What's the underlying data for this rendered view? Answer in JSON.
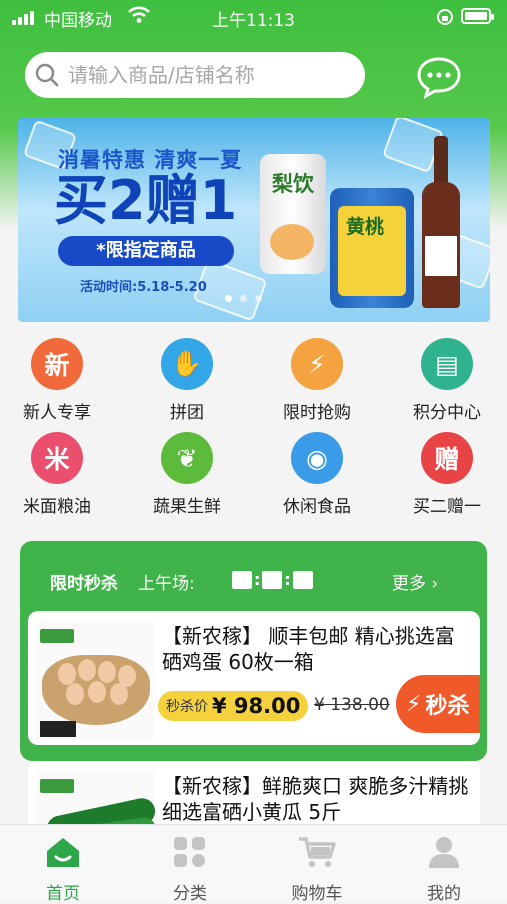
{
  "status": {
    "carrier": "中国移动",
    "time": "上午11:13"
  },
  "search": {
    "placeholder": "请输入商品/店铺名称"
  },
  "banner": {
    "headline": "消暑特惠 清爽一夏",
    "promo": "买2赠1",
    "tag": "*限指定商品",
    "dates": "活动时间:5.18-5.20",
    "product1": "梨饮",
    "product2": "黄桃"
  },
  "categories": [
    {
      "label": "新人专享",
      "glyph": "新",
      "color": "#f06a3b",
      "icon": "new-icon"
    },
    {
      "label": "拼团",
      "glyph": "✋",
      "color": "#33a6e8",
      "icon": "group-hands-icon"
    },
    {
      "label": "限时抢购",
      "glyph": "⚡",
      "color": "#f5a341",
      "icon": "flash-bolt-icon"
    },
    {
      "label": "积分中心",
      "glyph": "▤",
      "color": "#2fb38f",
      "icon": "points-icon"
    },
    {
      "label": "米面粮油",
      "glyph": "米",
      "color": "#ea4f6e",
      "icon": "rice-icon"
    },
    {
      "label": "蔬果生鲜",
      "glyph": "❦",
      "color": "#5cbb3a",
      "icon": "vegetable-icon"
    },
    {
      "label": "休闲食品",
      "glyph": "◉",
      "color": "#3a9be8",
      "icon": "lollipop-icon"
    },
    {
      "label": "买二赠一",
      "glyph": "赠",
      "color": "#e84446",
      "icon": "gift-icon"
    }
  ],
  "flash_sale": {
    "title": "限时秒杀",
    "session": "上午场:",
    "more": "更多 ›",
    "products": [
      {
        "title": "【新农稼】 顺丰包邮 精心挑选富硒鸡蛋 60枚一箱",
        "price_label": "秒杀价",
        "price": "¥ 98.00",
        "original_price": "¥ 138.00",
        "button": "秒杀"
      },
      {
        "title": "【新农稼】鲜脆爽口 爽脆多汁精挑细选富硒小黄瓜 5斤"
      }
    ]
  },
  "tabbar": [
    {
      "label": "首页",
      "icon": "home-icon",
      "active": true
    },
    {
      "label": "分类",
      "icon": "category-grid-icon",
      "active": false
    },
    {
      "label": "购物车",
      "icon": "cart-icon",
      "active": false
    },
    {
      "label": "我的",
      "icon": "profile-icon",
      "active": false
    }
  ],
  "colors": {
    "brand_green": "#3fbf3f",
    "active_tab": "#2ea74a",
    "price_badge": "#f4d13d",
    "kill_button": "#f0592a"
  }
}
